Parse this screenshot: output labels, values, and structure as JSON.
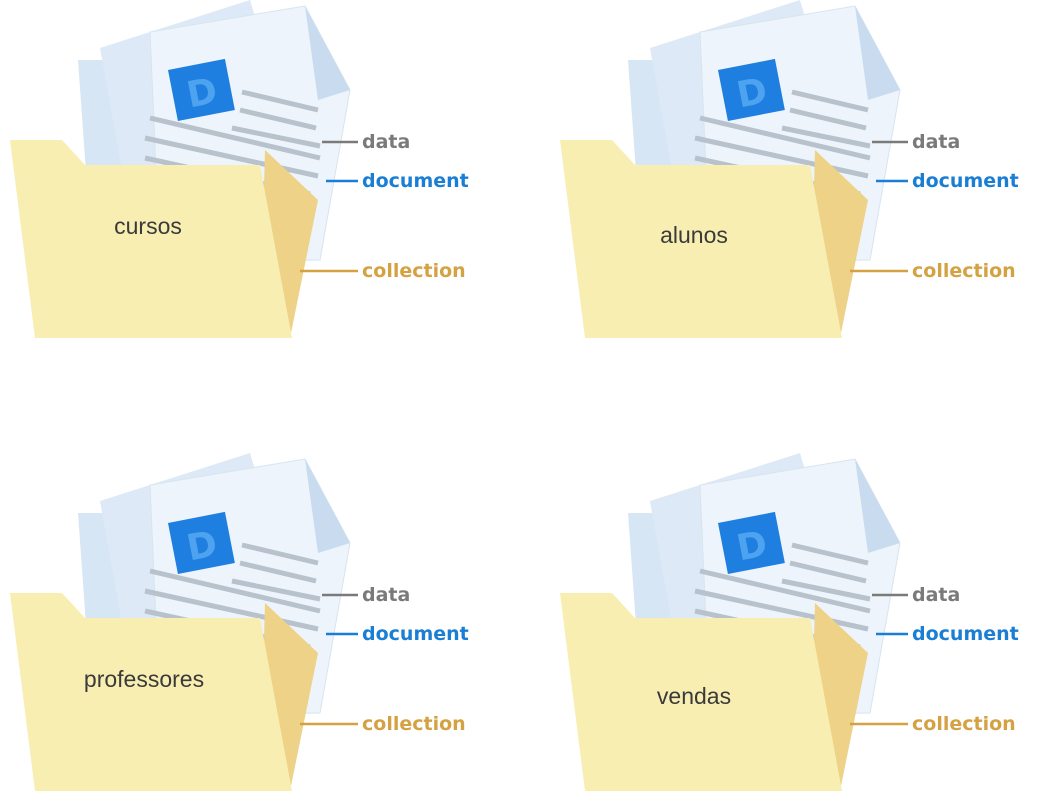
{
  "folders": [
    {
      "name": "cursos"
    },
    {
      "name": "alunos"
    },
    {
      "name": "professores"
    },
    {
      "name": "vendas"
    }
  ],
  "doc_icon_letter": "D",
  "labels": {
    "data": "data",
    "document": "document",
    "collection": "collection"
  },
  "colors": {
    "data": "#7a7a7a",
    "document": "#1a7fd4",
    "collection": "#d4a243",
    "folder_front": "#f8eeb2",
    "folder_back": "#f0dc9a",
    "folder_side": "#ecd087",
    "doc_icon": "#1f7fe0",
    "page": "#eaf3fb",
    "page_lines": "#b8c2cc"
  }
}
